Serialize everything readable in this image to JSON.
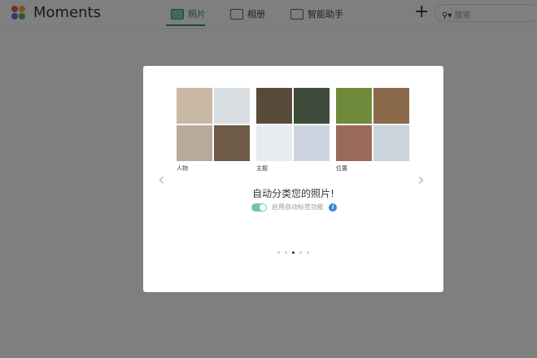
{
  "header": {
    "app_title": "Moments",
    "tabs": [
      {
        "label": "照片",
        "active": true
      },
      {
        "label": "相册"
      },
      {
        "label": "智能助手"
      }
    ],
    "search_placeholder": "搜索"
  },
  "modal": {
    "groups": [
      {
        "label": "人物",
        "colors": [
          "#c9b8a4",
          "#d8dde2",
          "#b9a99a",
          "#6e5a48"
        ]
      },
      {
        "label": "主题",
        "colors": [
          "#5a4a3a",
          "#3e4a3a",
          "#e8ecef",
          "#cdd6e0"
        ]
      },
      {
        "label": "位置",
        "colors": [
          "#6e8a3a",
          "#8a6a4a",
          "#9a6a5a",
          "#c9d4dc"
        ]
      }
    ],
    "headline": "自动分类您的照片!",
    "toggle_label": "启用自动标签功能",
    "toggle_on": true,
    "page_count": 5,
    "current_page": 3
  }
}
